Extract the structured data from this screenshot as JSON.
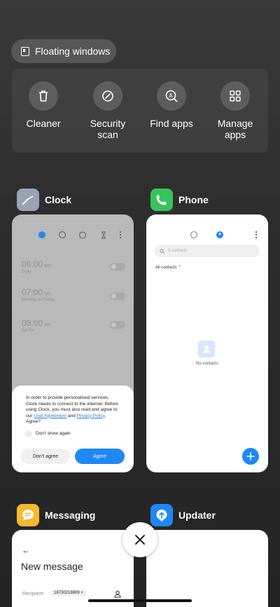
{
  "floating_windows": {
    "label": "Floating windows"
  },
  "tools": [
    {
      "label": "Cleaner",
      "icon": "trash-icon"
    },
    {
      "label": "Security\nscan",
      "icon": "security-scan-icon"
    },
    {
      "label": "Find apps",
      "icon": "find-apps-icon"
    },
    {
      "label": "Manage\napps",
      "icon": "manage-apps-icon"
    }
  ],
  "apps": {
    "clock": {
      "name": "Clock",
      "icon_color": "#9aa3b5",
      "alarms": [
        {
          "time": "06:00",
          "ampm": "am",
          "repeat": "Daily"
        },
        {
          "time": "07:00",
          "ampm": "am",
          "repeat": "Monday to Friday"
        },
        {
          "time": "08:00",
          "ampm": "am",
          "repeat": "Set list"
        }
      ],
      "dialog": {
        "text_before": "In order to provide personalised services, Clock needs to connect to the internet. Before using Clock, you must also read and agree to our ",
        "link1": "User Agreement",
        "text_mid": " and ",
        "link2": "Privacy Policy",
        "text_after": ". Agree?",
        "checkbox": "Don't show again",
        "decline": "Don't agree",
        "accept": "Agree"
      }
    },
    "phone": {
      "name": "Phone",
      "icon_color": "#36c45b",
      "search_placeholder": "0 contacts",
      "filter": "All contacts",
      "empty": "No contacts",
      "accent": "#1e88f5"
    },
    "messaging": {
      "name": "Messaging",
      "icon_color": "#f5b82e",
      "title": "New message",
      "recipient_label": "Recipient:",
      "recipient_value": "18730218809"
    },
    "updater": {
      "name": "Updater",
      "icon_color": "#1e88f5"
    }
  }
}
